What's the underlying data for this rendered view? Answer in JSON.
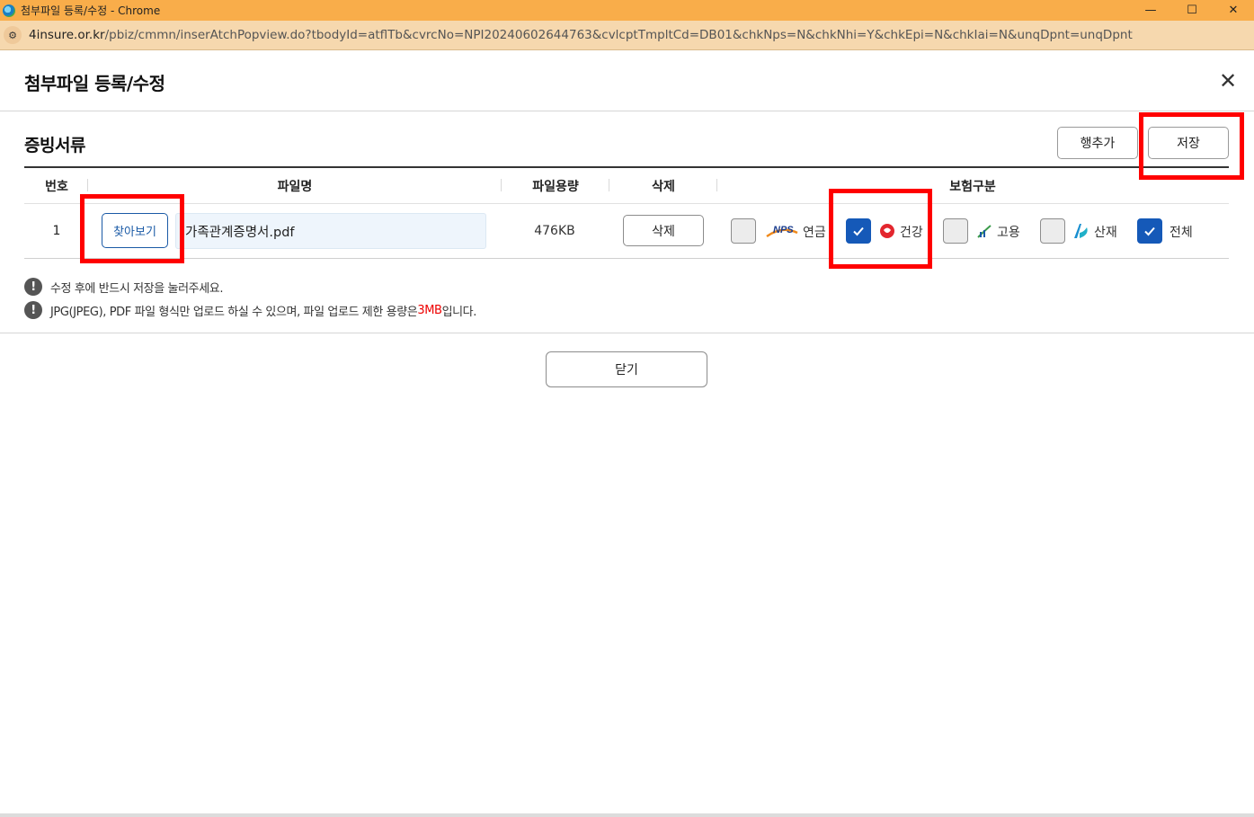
{
  "window": {
    "title": "첨부파일 등록/수정 - Chrome",
    "minimize": "—",
    "maximize": "☐",
    "close": "✕"
  },
  "address": {
    "domain": "4insure.or.kr",
    "path": "/pbiz/cmmn/inserAtchPopview.do?tbodyId=atflTb&cvrcNo=NPI20240602644763&cvlcptTmpltCd=DB01&chkNps=N&chkNhi=Y&chkEpi=N&chkIai=N&unqDpnt=unqDpnt"
  },
  "popup": {
    "title": "첨부파일 등록/수정",
    "close_icon": "close-icon"
  },
  "section": {
    "title": "증빙서류",
    "add_row_label": "행추가",
    "save_label": "저장"
  },
  "table": {
    "headers": {
      "number": "번호",
      "file_name": "파일명",
      "file_size": "파일용량",
      "delete": "삭제",
      "insurance": "보험구분"
    },
    "rows": [
      {
        "number": "1",
        "browse_label": "찾아보기",
        "file_name": "가족관계증명서.pdf",
        "file_size": "476KB",
        "delete_label": "삭제",
        "insurance": [
          {
            "name": "연금",
            "logo": "NPS",
            "checked": false
          },
          {
            "name": "건강",
            "logo": "health-logo",
            "checked": true
          },
          {
            "name": "고용",
            "logo": "employment-logo",
            "checked": false
          },
          {
            "name": "산재",
            "logo": "industrial-logo",
            "checked": false
          },
          {
            "name": "전체",
            "logo": "",
            "checked": true
          }
        ]
      }
    ]
  },
  "notes": {
    "line1": "수정 후에 반드시 저장을 눌러주세요.",
    "line2_pre": "JPG(JPEG), PDF 파일 형식만 업로드 하실 수 있으며, 파일 업로드 제한 용량은 ",
    "line2_limit": "3MB",
    "line2_post": " 입니다."
  },
  "footer": {
    "close_label": "닫기"
  },
  "colors": {
    "titlebar": "#f9ad4a",
    "accent_blue": "#1559b8",
    "highlight_red": "#ff0000"
  }
}
